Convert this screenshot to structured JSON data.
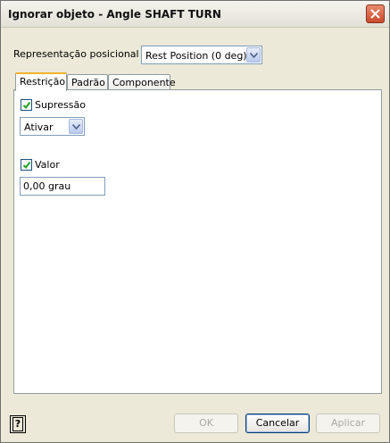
{
  "window": {
    "title": "Ignorar objeto - Angle SHAFT TURN"
  },
  "positional": {
    "label": "Representação posicional",
    "selected": "Rest Position (0 deg)"
  },
  "tabs": [
    {
      "label": "Restrição",
      "active": true
    },
    {
      "label": "Padrão",
      "active": false
    },
    {
      "label": "Componente",
      "active": false
    }
  ],
  "restriction": {
    "suppression_label": "Supressão",
    "suppression_checked": true,
    "suppression_select": "Ativar",
    "value_label": "Valor",
    "value_checked": true,
    "value_field": "0,00 grau"
  },
  "footer": {
    "help_glyph": "?",
    "ok_label": "OK",
    "cancel_label": "Cancelar",
    "apply_label": "Aplicar"
  }
}
